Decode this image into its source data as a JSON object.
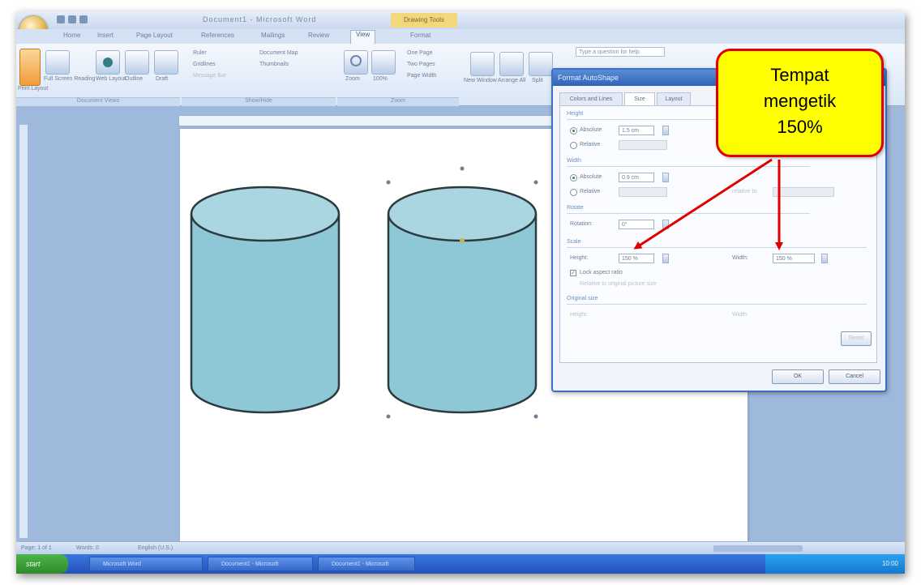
{
  "app": {
    "title": "Document1 - Microsoft Word",
    "context_tab_title": "Drawing Tools"
  },
  "menu": {
    "tabs": [
      "Home",
      "Insert",
      "Page Layout",
      "References",
      "Mailings",
      "Review",
      "View",
      "Format"
    ],
    "active_tab": "View"
  },
  "ribbon": {
    "buttons": [
      {
        "label": "Print Layout",
        "icon": "page-icon"
      },
      {
        "label": "Full Screen Reading",
        "icon": "book-icon"
      },
      {
        "label": "Web Layout",
        "icon": "globe-icon"
      },
      {
        "label": "Outline",
        "icon": "outline-icon"
      },
      {
        "label": "Draft",
        "icon": "draft-icon"
      }
    ],
    "checks": [
      "Ruler",
      "Gridlines",
      "Message Bar",
      "Document Map",
      "Thumbnails"
    ],
    "zoom_buttons": [
      "Zoom",
      "100%"
    ],
    "zoom_options": [
      "One Page",
      "Two Pages",
      "Page Width"
    ],
    "window_buttons": [
      "New Window",
      "Arrange All",
      "Split"
    ],
    "groups": [
      "Document Views",
      "Show/Hide",
      "Zoom"
    ],
    "search_box": "Type a question for help"
  },
  "dialog": {
    "title": "Format AutoShape",
    "tabs": [
      "Colors and Lines",
      "Size",
      "Layout"
    ],
    "active_tab": "Size",
    "height": {
      "section": "Height",
      "absolute_label": "Absolute",
      "absolute_value": "1.5 cm",
      "relative_label": "Relative"
    },
    "width": {
      "section": "Width",
      "absolute_label": "Absolute",
      "absolute_value": "0.9 cm",
      "relative_label": "Relative",
      "relative_to_label": "relative to"
    },
    "rotate": {
      "section": "Rotate",
      "rotation_label": "Rotation:",
      "rotation_value": "0°"
    },
    "scale": {
      "section": "Scale",
      "height_label": "Height:",
      "height_value": "150 %",
      "width_label": "Width:",
      "width_value": "150 %",
      "lock_aspect_label": "Lock aspect ratio",
      "relative_original_label": "Relative to original picture size"
    },
    "original_size": {
      "section": "Original size",
      "height_label": "Height:",
      "width_label": "Width:",
      "reset_button": "Reset"
    },
    "ok_button": "OK",
    "cancel_button": "Cancel"
  },
  "status": {
    "page": "Page: 1 of 1",
    "words": "Words: 0",
    "language": "English (U.S.)"
  },
  "taskbar": {
    "start": "start",
    "items": [
      "Microsoft Word",
      "Document1 - Microsoft",
      "Document1 - Microsoft"
    ],
    "tray_time": "10:00"
  },
  "callout": {
    "text": "Tempat\nmengetik\n150%"
  },
  "colors": {
    "shape_fill": "#8ec8d6",
    "shape_top": "#a9d6e1",
    "shape_stroke": "#2c3b3f",
    "callout_fill": "#ffff00",
    "callout_border": "#e00000",
    "arrow": "#e00000"
  }
}
